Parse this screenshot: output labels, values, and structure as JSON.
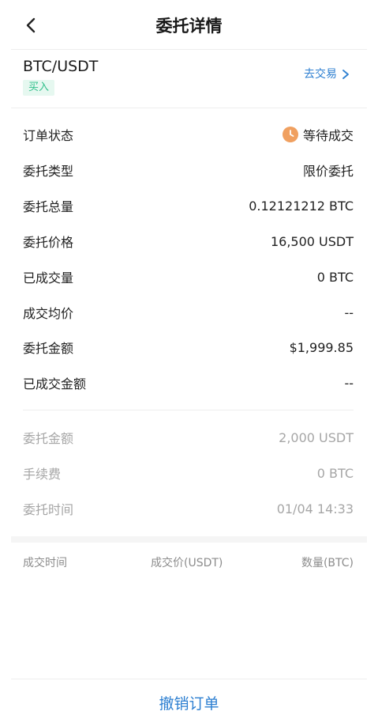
{
  "header": {
    "title": "委托详情",
    "back_icon": "chevron-left-icon"
  },
  "order": {
    "pair": "BTC/USDT",
    "side": "买入",
    "goto_trade": "去交易",
    "status_color": "#f0a060"
  },
  "details": [
    {
      "label": "订单状态",
      "value": "等待成交",
      "icon": "clock-icon"
    },
    {
      "label": "委托类型",
      "value": "限价委托"
    },
    {
      "label": "委托总量",
      "value": "0.12121212 BTC"
    },
    {
      "label": "委托价格",
      "value": "16,500 USDT"
    },
    {
      "label": "已成交量",
      "value": "0 BTC"
    },
    {
      "label": "成交均价",
      "value": "--"
    },
    {
      "label": "委托金额",
      "value": "$1,999.85"
    },
    {
      "label": "已成交金额",
      "value": "--"
    }
  ],
  "extra": [
    {
      "label": "委托金额",
      "value": "2,000 USDT"
    },
    {
      "label": "手续费",
      "value": "0 BTC"
    },
    {
      "label": "委托时间",
      "value": "01/04 14:33"
    }
  ],
  "fills_table": {
    "columns": [
      "成交时间",
      "成交价(USDT)",
      "数量(BTC)"
    ]
  },
  "footer": {
    "cancel_label": "撤销订单"
  },
  "colors": {
    "accent": "#2d7fd1",
    "buy_green": "#2fbf8a",
    "badge_bg": "#e6f8f0"
  }
}
